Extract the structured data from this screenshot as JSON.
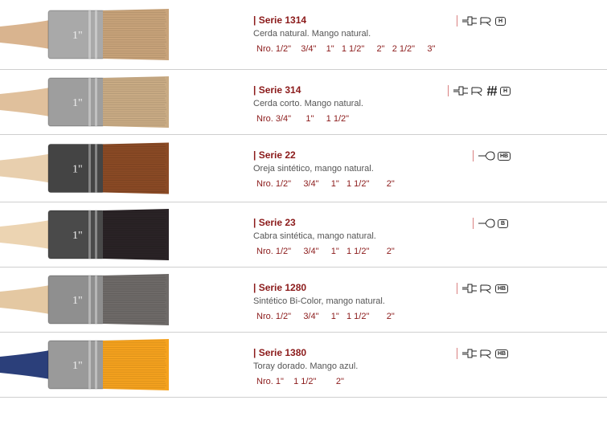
{
  "colors": {
    "accent": "#8b1a1a",
    "divider": "#cfcfcf",
    "text": "#555555"
  },
  "products": [
    {
      "title": "| Serie 1314",
      "description": "Cerda natural. Mango natural.",
      "sizes": "Nro. 1/2\"    3/4\"    1\"   1 1/2\"     2\"   2 1/2\"     3\"",
      "icons": [
        "flat-brush-icon",
        "filbert-brush-icon"
      ],
      "badge": "H",
      "handle_color": "#d9b48f",
      "ferrule_color": "#a9a9a9",
      "bristle_color": "#c8a37a"
    },
    {
      "title": "| Serie 314",
      "description": "Cerda corto. Mango natural.",
      "sizes": "Nro. 3/4\"      1\"     1 1/2\"",
      "icons": [
        "flat-brush-icon",
        "filbert-brush-icon",
        "hatch-icon"
      ],
      "badge": "H",
      "handle_color": "#e0c09c",
      "ferrule_color": "#9e9e9e",
      "bristle_color": "#c9ab84"
    },
    {
      "title": "| Serie 22",
      "description": "Oreja sintético, mango natural.",
      "sizes": "Nro. 1/2\"     3/4\"     1\"   1 1/2\"       2\"",
      "icons": [
        "round-brush-icon"
      ],
      "badge": "HB",
      "handle_color": "#e8cfae",
      "ferrule_color": "#444444",
      "bristle_color": "#8a4a25"
    },
    {
      "title": "| Serie 23",
      "description": "Cabra sintética, mango natural.",
      "sizes": "Nro. 1/2\"     3/4\"     1\"   1 1/2\"       2\"",
      "icons": [
        "round-brush-icon"
      ],
      "badge": "B",
      "handle_color": "#ecd4b2",
      "ferrule_color": "#4a4a4a",
      "bristle_color": "#2a2326"
    },
    {
      "title": "| Serie 1280",
      "description": "Sintético Bi-Color, mango natural.",
      "sizes": "Nro. 1/2\"     3/4\"     1\"   1 1/2\"       2\"",
      "icons": [
        "flat-brush-icon",
        "filbert-brush-icon"
      ],
      "badge": "HB",
      "handle_color": "#e4c8a2",
      "ferrule_color": "#8f8f8f",
      "bristle_color": "#6e6a68"
    },
    {
      "title": "| Serie 1380",
      "description": "Toray dorado. Mango azul.",
      "sizes": "Nro. 1\"    1 1/2\"        2\"",
      "icons": [
        "flat-brush-icon",
        "filbert-brush-icon"
      ],
      "badge": "HB",
      "handle_color": "#2b3f7a",
      "ferrule_color": "#9a9a9a",
      "bristle_color": "#f5a21e"
    }
  ]
}
